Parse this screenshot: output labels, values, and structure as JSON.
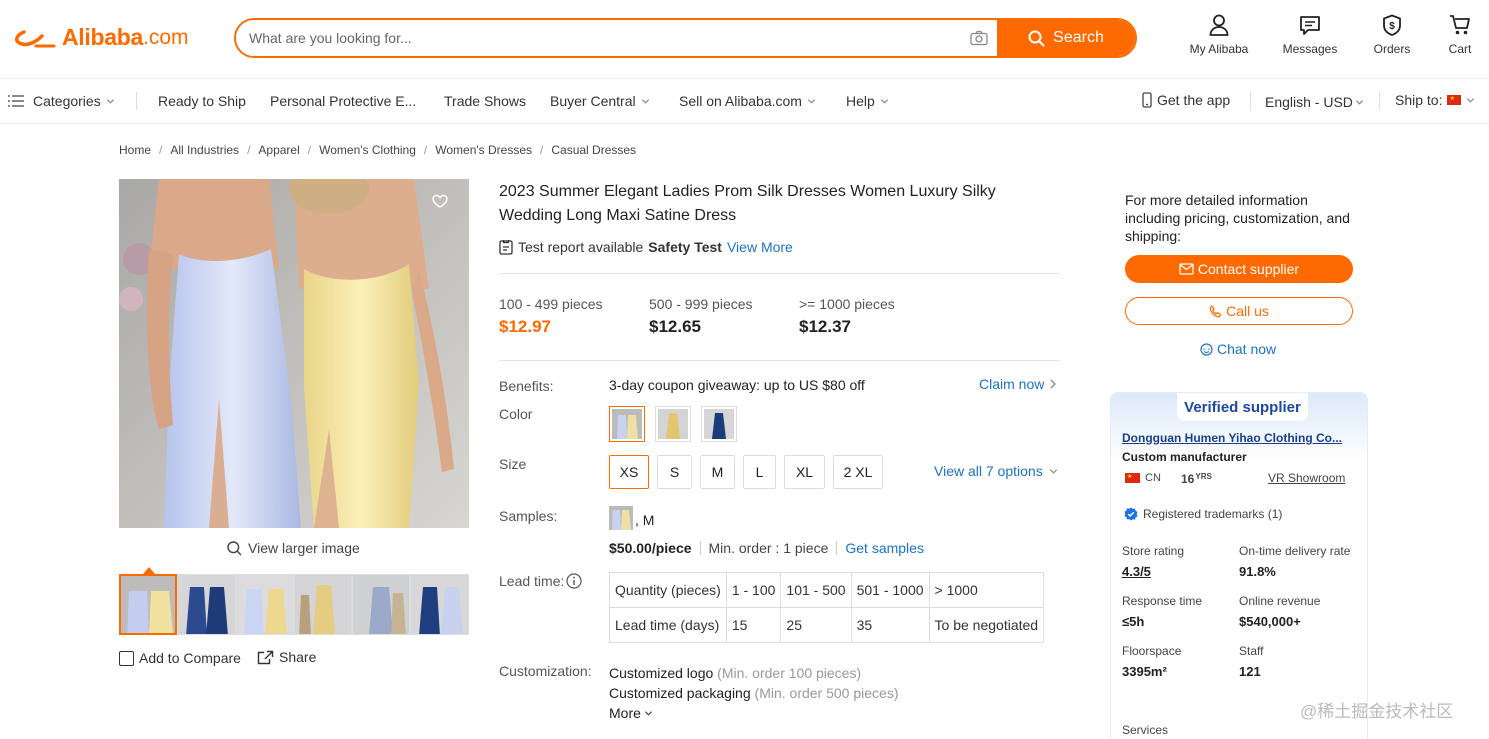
{
  "header": {
    "logo_word": "Alibaba",
    "logo_domain": ".com",
    "search_placeholder": "What are you looking for...",
    "search_button": "Search",
    "actions": [
      {
        "label": "My Alibaba",
        "icon": "user-icon"
      },
      {
        "label": "Messages",
        "icon": "message-icon"
      },
      {
        "label": "Orders",
        "icon": "orders-icon"
      },
      {
        "label": "Cart",
        "icon": "cart-icon"
      }
    ]
  },
  "nav": {
    "categories": "Categories",
    "items": [
      "Ready to Ship",
      "Personal Protective E...",
      "Trade Shows",
      "Buyer Central",
      "Sell on Alibaba.com",
      "Help"
    ],
    "get_app": "Get the app",
    "language": "English - USD",
    "ship_to": "Ship to:"
  },
  "breadcrumb": [
    "Home",
    "All Industries",
    "Apparel",
    "Women's Clothing",
    "Women's Dresses",
    "Casual Dresses"
  ],
  "gallery": {
    "view_larger": "View larger image",
    "add_compare": "Add to Compare",
    "share": "Share"
  },
  "product": {
    "title": "2023 Summer Elegant Ladies Prom Silk Dresses Women Luxury Silky Wedding Long Maxi Satine Dress",
    "test_report": "Test report available",
    "safety_test": "Safety Test",
    "view_more": "View More",
    "price_tiers": [
      {
        "range": "100 - 499 pieces",
        "price": "$12.97"
      },
      {
        "range": "500 - 999 pieces",
        "price": "$12.65"
      },
      {
        "range": ">= 1000 pieces",
        "price": "$12.37"
      }
    ],
    "benefits_label": "Benefits:",
    "benefits_text": "3-day coupon giveaway: up to US $80 off",
    "claim_now": "Claim now",
    "color_label": "Color",
    "size_label": "Size",
    "sizes": [
      "XS",
      "S",
      "M",
      "L",
      "XL",
      "2 XL"
    ],
    "view_all_options": "View all 7 options",
    "samples_label": "Samples:",
    "sample_variant": ", M",
    "sample_price": "$50.00/piece",
    "sample_min_order": "Min. order : 1 piece",
    "get_samples": "Get samples",
    "lead_time_label": "Lead time:",
    "lead_table": {
      "rows": [
        [
          "Quantity (pieces)",
          "1 - 100",
          "101 - 500",
          "501 - 1000",
          "> 1000"
        ],
        [
          "Lead time (days)",
          "15",
          "25",
          "35",
          "To be negotiated"
        ]
      ]
    },
    "customization_label": "Customization:",
    "customizations": [
      {
        "name": "Customized logo",
        "note": "(Min. order 100 pieces)"
      },
      {
        "name": "Customized packaging",
        "note": "(Min. order 500 pieces)"
      }
    ],
    "more": "More"
  },
  "supplier_panel": {
    "intro": "For more detailed information including pricing, customization, and shipping:",
    "contact": "Contact supplier",
    "call": "Call us",
    "chat": "Chat now",
    "verified": "Verified supplier",
    "name": "Dongguan Humen Yihao Clothing Co...",
    "type": "Custom manufacturer",
    "country": "CN",
    "years": "16",
    "years_unit": "YRS",
    "vr": "VR Showroom",
    "trademarks": "Registered trademarks (1)",
    "stats": [
      {
        "label": "Store rating",
        "value": "4.3/5"
      },
      {
        "label": "On-time delivery rate",
        "value": "91.8%"
      },
      {
        "label": "Response time",
        "value": "≤5h"
      },
      {
        "label": "Online revenue",
        "value": "$540,000+"
      },
      {
        "label": "Floorspace",
        "value": "3395m²"
      },
      {
        "label": "Staff",
        "value": "121"
      }
    ],
    "services": "Services"
  },
  "watermark": "@稀土掘金技术社区",
  "colors": {
    "brand": "#ff6a00",
    "link": "#1a73c8",
    "verified": "#1b4aa0"
  }
}
